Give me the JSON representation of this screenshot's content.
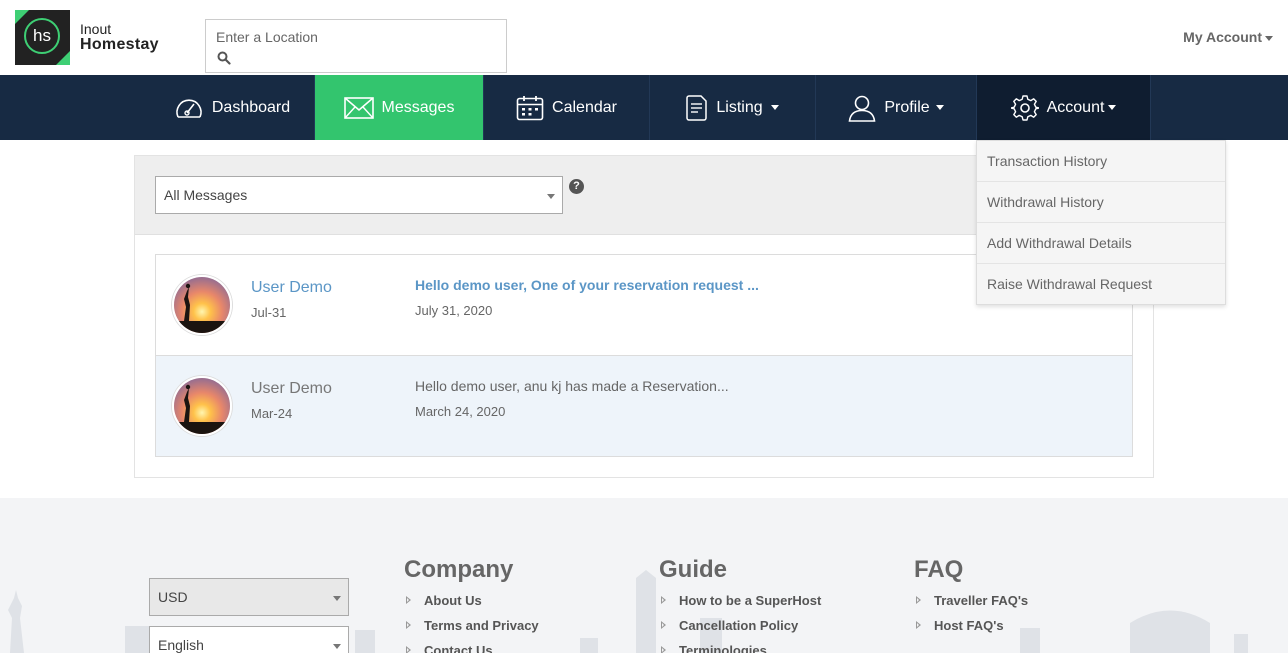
{
  "brand": {
    "logo_initials": "hs",
    "name_top": "Inout",
    "name_bottom": "Homestay"
  },
  "search": {
    "placeholder": "Enter a Location"
  },
  "header": {
    "my_account": "My Account"
  },
  "nav": {
    "items": [
      {
        "label": "Dashboard",
        "icon": "speedometer-icon"
      },
      {
        "label": "Messages",
        "icon": "envelope-icon",
        "active": true
      },
      {
        "label": "Calendar",
        "icon": "calendar-icon"
      },
      {
        "label": "Listing",
        "icon": "document-icon",
        "dropdown": true
      },
      {
        "label": "Profile",
        "icon": "user-icon",
        "dropdown": true
      },
      {
        "label": "Account",
        "icon": "gear-icon",
        "dropdown": true,
        "open": true
      }
    ]
  },
  "account_menu": {
    "items": [
      "Transaction History",
      "Withdrawal History",
      "Add Withdrawal Details",
      "Raise Withdrawal Request"
    ]
  },
  "messages": {
    "filter": {
      "selected": "All Messages"
    },
    "help": "?",
    "rows": [
      {
        "name": "User Demo",
        "short_date": "Jul-31",
        "text": "Hello demo user, One of your reservation request ...",
        "date": "July 31, 2020",
        "unread": true
      },
      {
        "name": "User Demo",
        "short_date": "Mar-24",
        "text": "Hello demo user, anu kj has made a Reservation...",
        "date": "March 24, 2020",
        "unread": false
      }
    ]
  },
  "footer": {
    "currency": "USD",
    "language": "English",
    "columns": [
      {
        "title": "Company",
        "links": [
          "About Us",
          "Terms and Privacy",
          "Contact Us"
        ]
      },
      {
        "title": "Guide",
        "links": [
          "How to be a SuperHost",
          "Cancellation Policy",
          "Terminologies"
        ]
      },
      {
        "title": "FAQ",
        "links": [
          "Traveller FAQ's",
          "Host FAQ's"
        ]
      }
    ]
  },
  "colors": {
    "nav_bg": "#172a43",
    "active": "#33c56e",
    "link": "#5b96c6"
  }
}
